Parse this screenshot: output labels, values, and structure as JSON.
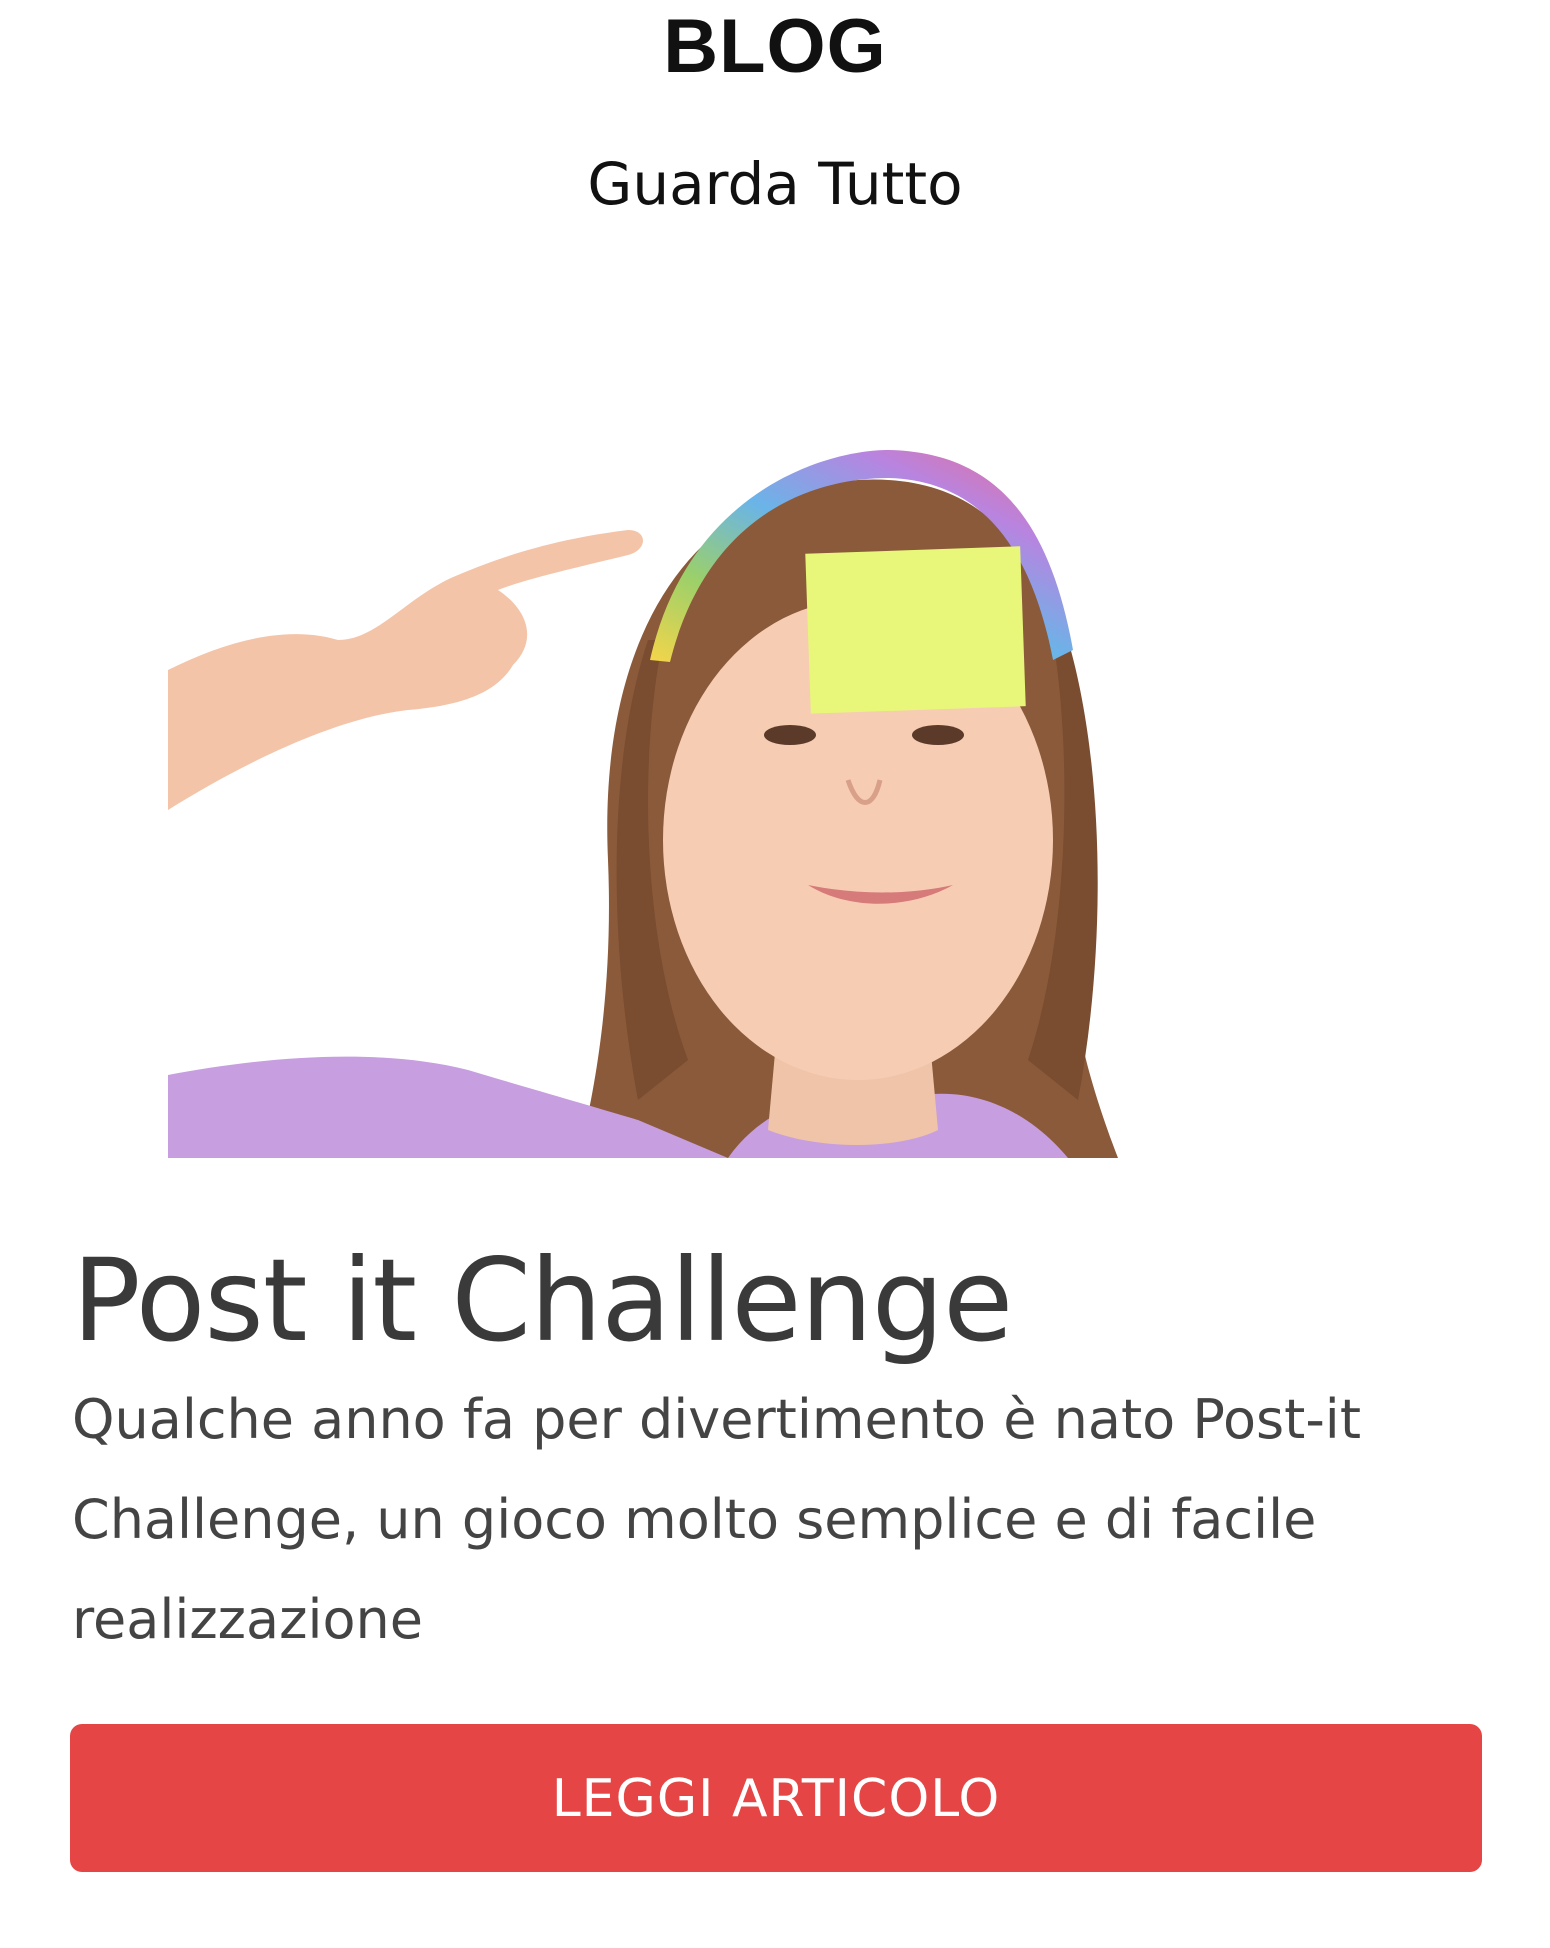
{
  "section": {
    "title": "BLOG",
    "see_all_label": "Guarda Tutto"
  },
  "post": {
    "image_description": "",
    "title": "Post it Challenge",
    "excerpt": "Qualche anno fa per divertimento è nato Post-it Challenge, un gioco molto semplice e di facile realizzazione",
    "button_label": "LEGGI ARTICOLO"
  },
  "colors": {
    "accent": "#e54545",
    "title_text": "#3a3a3a",
    "body_text": "#444444",
    "heading_text": "#111111"
  }
}
